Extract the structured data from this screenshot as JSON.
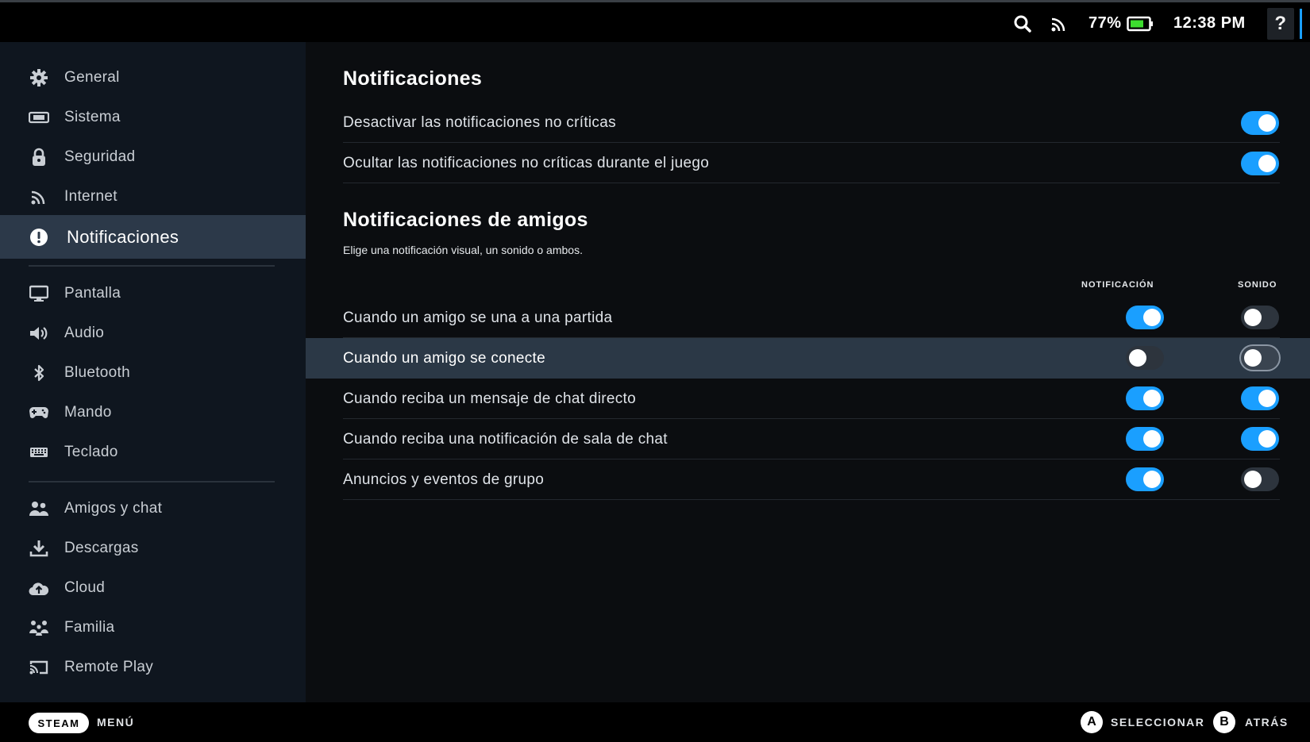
{
  "topbar": {
    "battery_percent": "77%",
    "battery_level": 0.77,
    "time": "12:38 PM",
    "help_label": "?"
  },
  "sidebar": {
    "items": [
      {
        "label": "General",
        "icon": "gear-icon"
      },
      {
        "label": "Sistema",
        "icon": "system-icon"
      },
      {
        "label": "Seguridad",
        "icon": "lock-icon"
      },
      {
        "label": "Internet",
        "icon": "wifi-icon"
      },
      {
        "label": "Notificaciones",
        "icon": "alert-icon",
        "active": true
      },
      {
        "label": "Pantalla",
        "icon": "monitor-icon"
      },
      {
        "label": "Audio",
        "icon": "speaker-icon"
      },
      {
        "label": "Bluetooth",
        "icon": "bluetooth-icon"
      },
      {
        "label": "Mando",
        "icon": "gamepad-icon"
      },
      {
        "label": "Teclado",
        "icon": "keyboard-icon"
      },
      {
        "label": "Amigos y chat",
        "icon": "friends-icon"
      },
      {
        "label": "Descargas",
        "icon": "download-icon"
      },
      {
        "label": "Cloud",
        "icon": "cloud-icon"
      },
      {
        "label": "Familia",
        "icon": "family-icon"
      },
      {
        "label": "Remote Play",
        "icon": "cast-icon"
      }
    ]
  },
  "main": {
    "section1_title": "Notificaciones",
    "general_rows": [
      {
        "label": "Desactivar las notificaciones no críticas",
        "on": true
      },
      {
        "label": "Ocultar las notificaciones no críticas durante el juego",
        "on": true
      }
    ],
    "section2_title": "Notificaciones de amigos",
    "section2_subtitle": "Elige una notificación visual, un sonido o ambos.",
    "col_notification": "NOTIFICACIÓN",
    "col_sound": "SONIDO",
    "friend_rows": [
      {
        "label": "Cuando un amigo se una a una partida",
        "notification": true,
        "sound": false
      },
      {
        "label": "Cuando un amigo se conecte",
        "notification": false,
        "sound": false,
        "highlighted": true
      },
      {
        "label": "Cuando reciba un mensaje de chat directo",
        "notification": true,
        "sound": true
      },
      {
        "label": "Cuando reciba una notificación de sala de chat",
        "notification": true,
        "sound": true
      },
      {
        "label": "Anuncios y eventos de grupo",
        "notification": true,
        "sound": false
      }
    ]
  },
  "bottombar": {
    "steam_label": "STEAM",
    "menu_label": "MENÚ",
    "a_button": "A",
    "select_label": "SELECCIONAR",
    "b_button": "B",
    "back_label": "ATRÁS"
  },
  "colors": {
    "accent": "#1a9fff",
    "sidebar_bg": "#0f161f",
    "active_bg": "#2c3949",
    "highlight_row": "#2b3846"
  }
}
